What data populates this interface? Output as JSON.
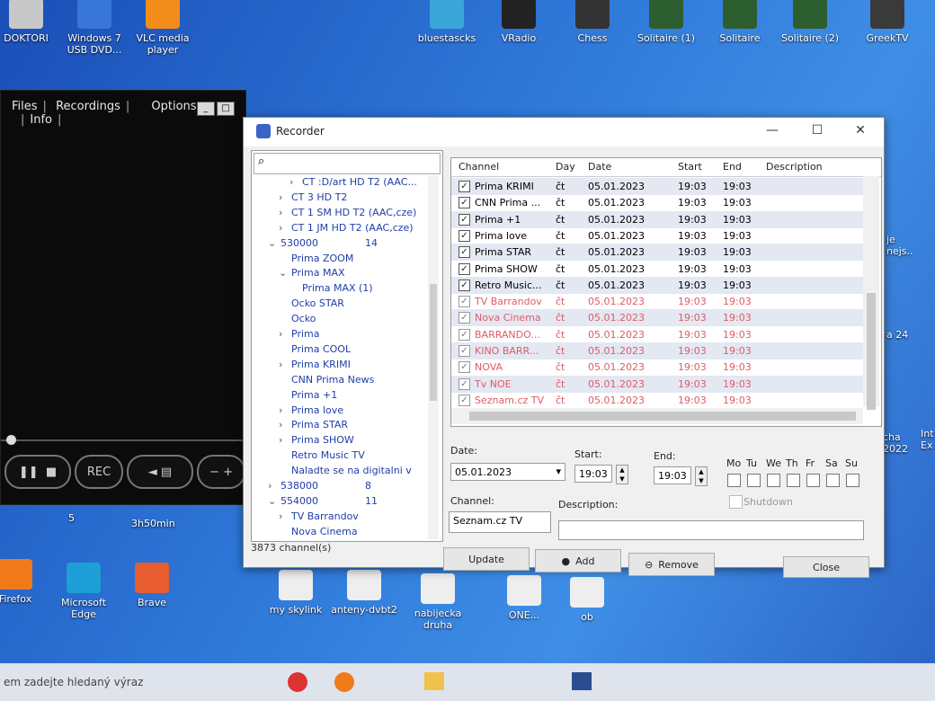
{
  "desktop": {
    "icons": [
      {
        "label": "DOKTORI"
      },
      {
        "label": "Windows 7 USB DVD..."
      },
      {
        "label": "VLC media player"
      },
      {
        "label": "bluestascks"
      },
      {
        "label": "VRadio"
      },
      {
        "label": "Chess"
      },
      {
        "label": "Solitaire (1)"
      },
      {
        "label": "Solitaire"
      },
      {
        "label": "Solitaire (2)"
      },
      {
        "label": "GreekTV"
      },
      {
        "label": "Firefox"
      },
      {
        "label": "Microsoft Edge"
      },
      {
        "label": "Brave"
      },
      {
        "label": "my skylink"
      },
      {
        "label": "anteny-dvbt2"
      },
      {
        "label": "nabijecka druha"
      },
      {
        "label": "ONE..."
      },
      {
        "label": "ob"
      }
    ],
    "misc_labels": [
      "5",
      "3h50min",
      "je nejs..",
      "a 24",
      "cha 2022",
      "Int Ex"
    ]
  },
  "player": {
    "menu": [
      "Files",
      "Recordings",
      "Options",
      "Info"
    ],
    "rec_label": "REC"
  },
  "recorder": {
    "title": "Recorder",
    "tree": [
      {
        "label": "CT :D/art HD T2 (AAC...",
        "indent": 3,
        "arrow": ">",
        "cnt": ""
      },
      {
        "label": "CT 3 HD T2",
        "indent": 2,
        "arrow": ">",
        "cnt": ""
      },
      {
        "label": "CT 1 SM HD T2 (AAC,cze)",
        "indent": 2,
        "arrow": ">",
        "cnt": ""
      },
      {
        "label": "CT 1 JM HD T2 (AAC,cze)",
        "indent": 2,
        "arrow": ">",
        "cnt": ""
      },
      {
        "label": "530000",
        "indent": 1,
        "arrow": "v",
        "cnt": "14"
      },
      {
        "label": "Prima ZOOM",
        "indent": 2,
        "arrow": "",
        "cnt": ""
      },
      {
        "label": "Prima MAX",
        "indent": 2,
        "arrow": "v",
        "cnt": ""
      },
      {
        "label": "Prima MAX (1)",
        "indent": 3,
        "arrow": "",
        "cnt": ""
      },
      {
        "label": "Ocko STAR",
        "indent": 2,
        "arrow": "",
        "cnt": ""
      },
      {
        "label": "Ocko",
        "indent": 2,
        "arrow": "",
        "cnt": ""
      },
      {
        "label": "Prima",
        "indent": 2,
        "arrow": ">",
        "cnt": ""
      },
      {
        "label": "Prima COOL",
        "indent": 2,
        "arrow": "",
        "cnt": ""
      },
      {
        "label": "Prima KRIMI",
        "indent": 2,
        "arrow": ">",
        "cnt": ""
      },
      {
        "label": "CNN Prima News",
        "indent": 2,
        "arrow": "",
        "cnt": ""
      },
      {
        "label": "Prima +1",
        "indent": 2,
        "arrow": "",
        "cnt": ""
      },
      {
        "label": "Prima love",
        "indent": 2,
        "arrow": ">",
        "cnt": ""
      },
      {
        "label": "Prima STAR",
        "indent": 2,
        "arrow": ">",
        "cnt": ""
      },
      {
        "label": "Prima SHOW",
        "indent": 2,
        "arrow": ">",
        "cnt": ""
      },
      {
        "label": "Retro Music TV",
        "indent": 2,
        "arrow": "",
        "cnt": ""
      },
      {
        "label": "Naladte se na digitalni v",
        "indent": 2,
        "arrow": "",
        "cnt": ""
      },
      {
        "label": "538000",
        "indent": 1,
        "arrow": ">",
        "cnt": "8"
      },
      {
        "label": "554000",
        "indent": 1,
        "arrow": "v",
        "cnt": "11"
      },
      {
        "label": "TV Barrandov",
        "indent": 2,
        "arrow": ">",
        "cnt": ""
      },
      {
        "label": "Nova Cinema",
        "indent": 2,
        "arrow": "",
        "cnt": ""
      }
    ],
    "status": "3873 channel(s)",
    "columns": [
      "Channel",
      "Day",
      "Date",
      "Start",
      "End",
      "Description"
    ],
    "rows": [
      {
        "channel": "Prima KRIMI",
        "day": "čt",
        "date": "05.01.2023",
        "start": "19:03",
        "end": "19:03",
        "active": true
      },
      {
        "channel": "CNN Prima ...",
        "day": "čt",
        "date": "05.01.2023",
        "start": "19:03",
        "end": "19:03",
        "active": true
      },
      {
        "channel": "Prima +1",
        "day": "čt",
        "date": "05.01.2023",
        "start": "19:03",
        "end": "19:03",
        "active": true
      },
      {
        "channel": "Prima love",
        "day": "čt",
        "date": "05.01.2023",
        "start": "19:03",
        "end": "19:03",
        "active": true
      },
      {
        "channel": "Prima STAR",
        "day": "čt",
        "date": "05.01.2023",
        "start": "19:03",
        "end": "19:03",
        "active": true
      },
      {
        "channel": "Prima SHOW",
        "day": "čt",
        "date": "05.01.2023",
        "start": "19:03",
        "end": "19:03",
        "active": true
      },
      {
        "channel": "Retro Music...",
        "day": "čt",
        "date": "05.01.2023",
        "start": "19:03",
        "end": "19:03",
        "active": true
      },
      {
        "channel": "TV Barrandov",
        "day": "čt",
        "date": "05.01.2023",
        "start": "19:03",
        "end": "19:03",
        "active": false
      },
      {
        "channel": "Nova Cinema",
        "day": "čt",
        "date": "05.01.2023",
        "start": "19:03",
        "end": "19:03",
        "active": false
      },
      {
        "channel": "BARRANDO...",
        "day": "čt",
        "date": "05.01.2023",
        "start": "19:03",
        "end": "19:03",
        "active": false
      },
      {
        "channel": "KINO BARR...",
        "day": "čt",
        "date": "05.01.2023",
        "start": "19:03",
        "end": "19:03",
        "active": false
      },
      {
        "channel": "NOVA",
        "day": "čt",
        "date": "05.01.2023",
        "start": "19:03",
        "end": "19:03",
        "active": false
      },
      {
        "channel": "Tv NOE",
        "day": "čt",
        "date": "05.01.2023",
        "start": "19:03",
        "end": "19:03",
        "active": false
      },
      {
        "channel": "Seznam.cz TV",
        "day": "čt",
        "date": "05.01.2023",
        "start": "19:03",
        "end": "19:03",
        "active": false
      }
    ],
    "form": {
      "date_label": "Date:",
      "date_value": "05.01.2023",
      "start_label": "Start:",
      "start_value": "19:03",
      "end_label": "End:",
      "end_value": "19:03",
      "days": [
        "Mo",
        "Tu",
        "We",
        "Th",
        "Fr",
        "Sa",
        "Su"
      ],
      "shutdown_label": "Shutdown",
      "channel_label": "Channel:",
      "channel_value": "Seznam.cz TV",
      "description_label": "Description:",
      "description_value": ""
    },
    "buttons": {
      "update": "Update",
      "add": "Add",
      "remove": "Remove",
      "close": "Close"
    }
  },
  "taskbar": {
    "search_placeholder": "em zadejte hledaný výraz"
  }
}
